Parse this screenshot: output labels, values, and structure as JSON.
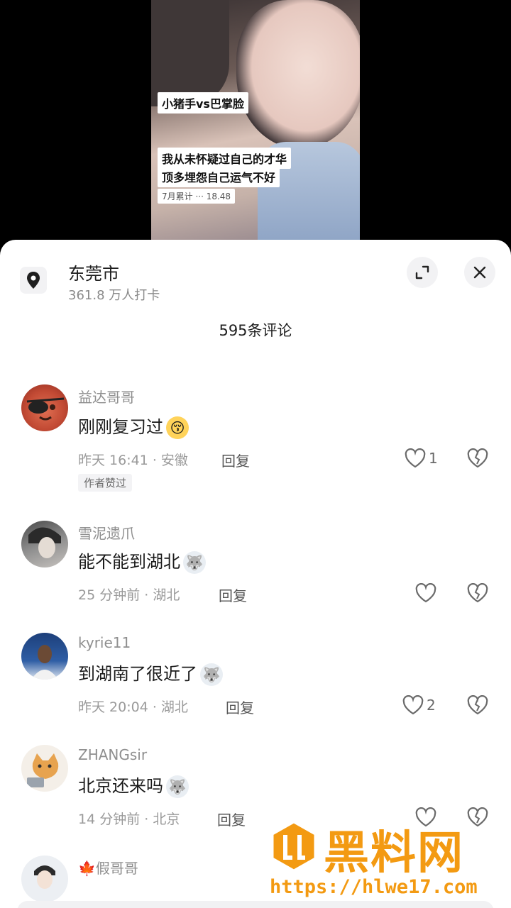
{
  "video": {
    "caption_1": "小猪手vs巴掌脸",
    "caption_2": "我从未怀疑过自己的才华",
    "caption_3": "顶多埋怨自己运气不好",
    "caption_4": "7月累计 ··· 18.48"
  },
  "location": {
    "name": "东莞市",
    "checkins": "361.8 万人打卡",
    "icon": "location-pin-icon"
  },
  "header": {
    "comment_count": "595条评论",
    "expand_icon": "expand-icon",
    "close_icon": "close-icon"
  },
  "comments": [
    {
      "user": "益达哥哥",
      "text": "刚刚复习过",
      "emoji": "😚",
      "meta": "昨天 16:41 · 安徽",
      "reply": "回复",
      "likes": "1",
      "tag": "作者赞过"
    },
    {
      "user": "雪泥遗爪",
      "text": "能不能到湖北",
      "emoji": "🐺",
      "meta": "25 分钟前 · 湖北",
      "reply": "回复",
      "likes": ""
    },
    {
      "user": "kyrie11",
      "text": "到湖南了很近了",
      "emoji": "🐺",
      "meta": "昨天 20:04 · 湖北",
      "reply": "回复",
      "likes": "2"
    },
    {
      "user": "ZHANGsir",
      "text": "北京还来吗",
      "emoji": "🐺",
      "meta": "14 分钟前 · 北京",
      "reply": "回复",
      "likes": ""
    },
    {
      "user": "假哥哥",
      "user_prefix": "🍁"
    }
  ],
  "watermark": {
    "title": "黑料网",
    "url": "https://hlwe17.com"
  },
  "colors": {
    "accent": "#f39a12",
    "meta": "#9a9a9a",
    "username": "#8f8f8f"
  }
}
